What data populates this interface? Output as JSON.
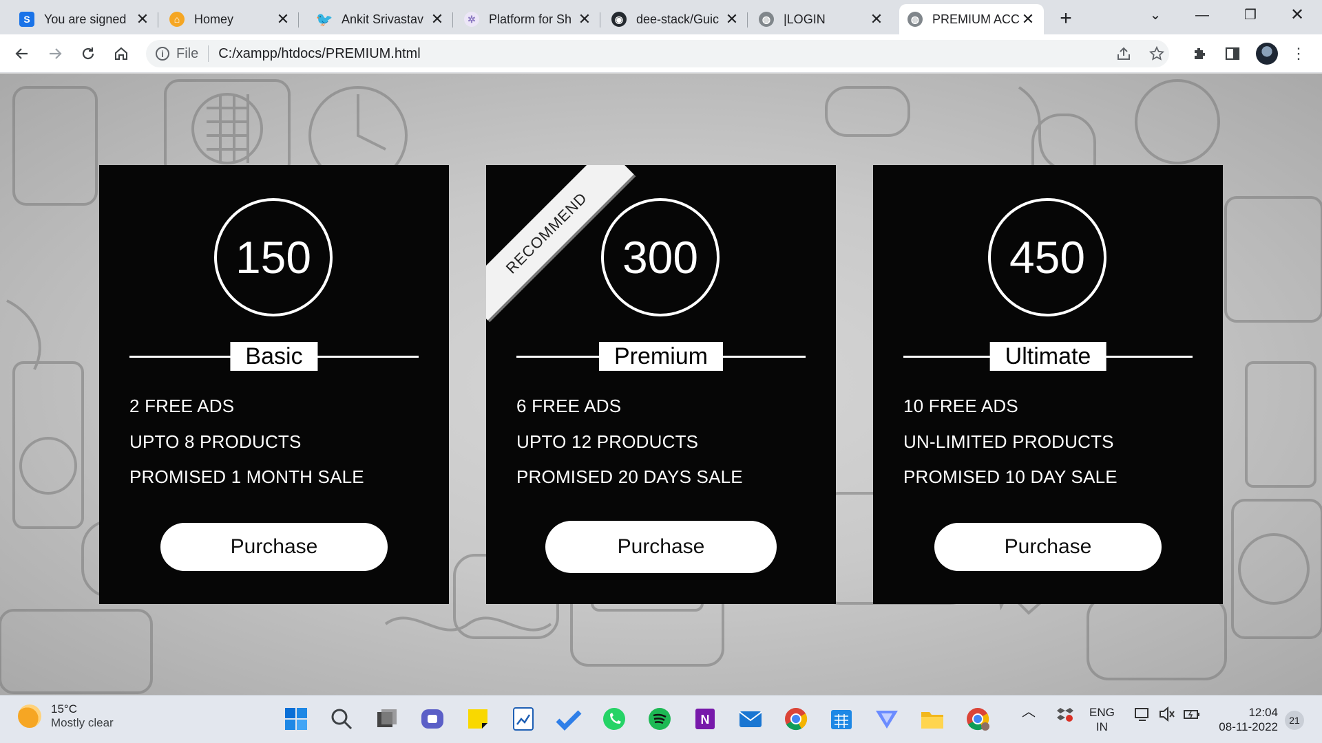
{
  "browser": {
    "tabs": [
      {
        "title": "You are signed",
        "icon": "s-icon",
        "color": "#1a73e8"
      },
      {
        "title": "Homey",
        "icon": "homey-icon",
        "color": "#f5a623"
      },
      {
        "title": "Ankit Srivastav",
        "icon": "twitter-icon",
        "color": "#1d9bf0"
      },
      {
        "title": "Platform for Sh",
        "icon": "platform-icon",
        "color": "#8e7cc3"
      },
      {
        "title": "dee-stack/Guic",
        "icon": "github-icon",
        "color": "#24292f"
      },
      {
        "title": "|LOGIN",
        "icon": "globe-icon",
        "color": "#5f6368"
      },
      {
        "title": "PREMIUM ACC",
        "icon": "globe-icon",
        "color": "#5f6368"
      }
    ],
    "address": {
      "scheme_label": "File",
      "url": "C:/xampp/htdocs/PREMIUM.html"
    }
  },
  "plans": [
    {
      "price": "150",
      "name": "Basic",
      "features": [
        "2 FREE ADS",
        "UPTO 8 PRODUCTS",
        "PROMISED 1 MONTH SALE"
      ],
      "button": "Purchase"
    },
    {
      "price": "300",
      "name": "Premium",
      "features": [
        "6 FREE ADS",
        "UPTO 12 PRODUCTS",
        "PROMISED 20 DAYS SALE"
      ],
      "button": "Purchase",
      "ribbon": "RECOMMEND"
    },
    {
      "price": "450",
      "name": "Ultimate",
      "features": [
        "10 FREE ADS",
        "UN-LIMITED PRODUCTS",
        "PROMISED 10 DAY SALE"
      ],
      "button": "Purchase"
    }
  ],
  "taskbar": {
    "weather": {
      "temp": "15°C",
      "desc": "Mostly clear"
    },
    "lang": [
      "ENG",
      "IN"
    ],
    "time": "12:04",
    "date": "08-11-2022",
    "notifications": "21",
    "apps": [
      "windows-start",
      "search",
      "task-view",
      "teams",
      "sticky-notes",
      "paint",
      "todo",
      "whatsapp",
      "spotify",
      "onenote",
      "mail",
      "chrome",
      "calendar",
      "vpn",
      "file-explorer",
      "chrome-profile"
    ]
  }
}
